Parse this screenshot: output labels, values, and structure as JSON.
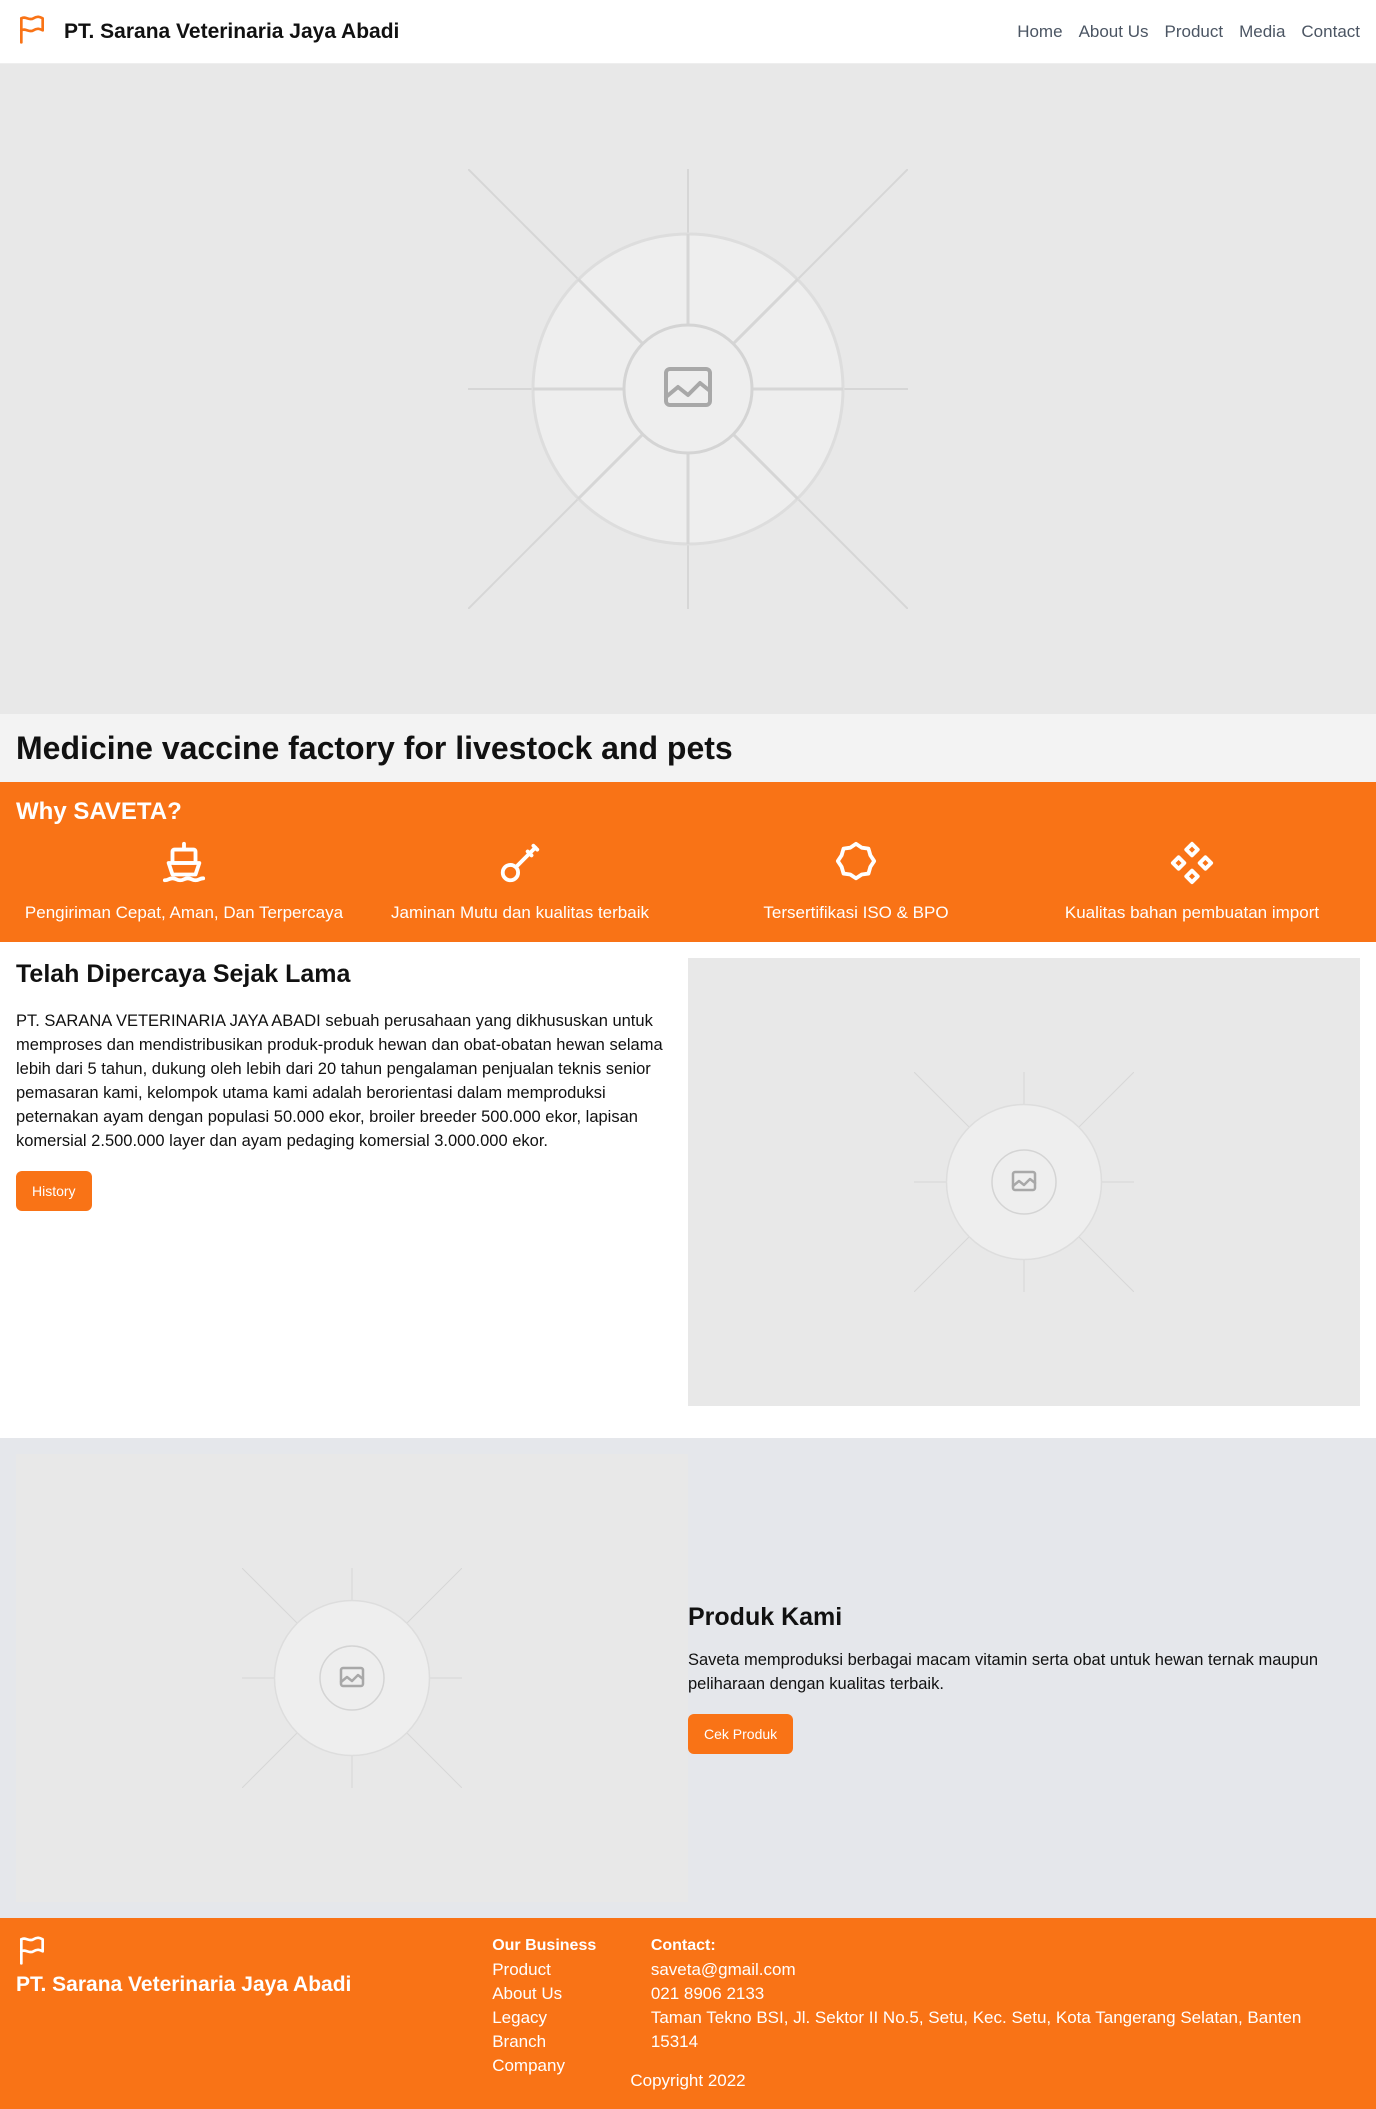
{
  "header": {
    "brand": "PT. Sarana Veterinaria Jaya Abadi",
    "nav": [
      "Home",
      "About Us",
      "Product",
      "Media",
      "Contact"
    ]
  },
  "hero": {
    "title": "Medicine vaccine factory for livestock and pets"
  },
  "why": {
    "title": "Why SAVETA?",
    "items": [
      {
        "icon": "ship-icon",
        "label": "Pengiriman Cepat, Aman, Dan Terpercaya"
      },
      {
        "icon": "key-icon",
        "label": "Jaminan Mutu dan kualitas terbaik"
      },
      {
        "icon": "badge-icon",
        "label": "Tersertifikasi ISO & BPO"
      },
      {
        "icon": "diamonds-icon",
        "label": "Kualitas bahan pembuatan import"
      }
    ]
  },
  "about": {
    "title": "Telah Dipercaya Sejak Lama",
    "body": "PT. SARANA VETERINARIA JAYA ABADI sebuah perusahaan yang dikhususkan untuk memproses dan mendistribusikan produk-produk hewan dan obat-obatan hewan selama lebih dari 5 tahun, dukung oleh lebih dari 20 tahun pengalaman penjualan teknis senior pemasaran kami, kelompok utama kami adalah berorientasi dalam memproduksi peternakan ayam dengan populasi 50.000 ekor, broiler breeder 500.000 ekor, lapisan komersial 2.500.000 layer dan ayam pedaging komersial 3.000.000 ekor.",
    "button": "History"
  },
  "product": {
    "title": "Produk Kami",
    "body": "Saveta memproduksi berbagai macam vitamin serta obat untuk hewan ternak maupun peliharaan dengan kualitas terbaik.",
    "button": "Cek Produk"
  },
  "footer": {
    "brand": "PT. Sarana Veterinaria Jaya Abadi",
    "business_title": "Our Business",
    "business_links": [
      "Product",
      "About Us",
      "Legacy",
      "Branch Company"
    ],
    "contact_title": "Contact:",
    "contact": [
      "saveta@gmail.com",
      "021 8906 2133",
      "Taman Tekno BSI, Jl. Sektor II No.5, Setu, Kec. Setu, Kota Tangerang Selatan, Banten 15314"
    ],
    "copyright": "Copyright 2022"
  },
  "colors": {
    "accent": "#f97316",
    "nav_text": "#4b5563",
    "placeholder_bg": "#e8e8e8"
  }
}
